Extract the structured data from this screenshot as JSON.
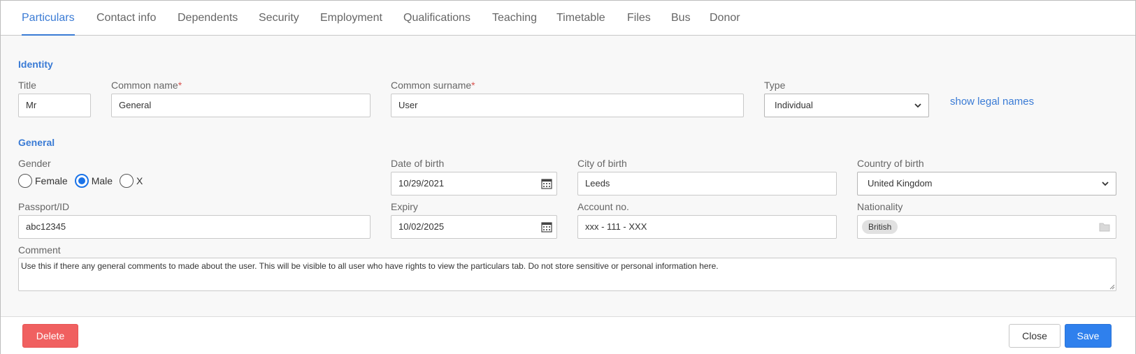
{
  "tabs": [
    "Particulars",
    "Contact info",
    "Dependents",
    "Security",
    "Employment",
    "Qualifications",
    "Teaching",
    "Timetable",
    "Files",
    "Bus",
    "Donor"
  ],
  "active_tab": "Particulars",
  "identity": {
    "heading": "Identity",
    "title_label": "Title",
    "title_value": "Mr",
    "common_name_label": "Common name",
    "common_name_value": "General",
    "common_surname_label": "Common surname",
    "common_surname_value": "User",
    "required_mark": "*",
    "type_label": "Type",
    "type_value": "Individual",
    "show_legal_names": "show legal names"
  },
  "general": {
    "heading": "General",
    "gender_label": "Gender",
    "gender_options": [
      "Female",
      "Male",
      "X"
    ],
    "gender_selected": "Male",
    "dob_label": "Date of birth",
    "dob_value": "10/29/2021",
    "city_label": "City of birth",
    "city_value": "Leeds",
    "country_label": "Country of birth",
    "country_value": "United Kingdom",
    "passport_label": "Passport/ID",
    "passport_value": "abc12345",
    "expiry_label": "Expiry",
    "expiry_value": "10/02/2025",
    "account_label": "Account no.",
    "account_value": "xxx - 111 - XXX",
    "nationality_label": "Nationality",
    "nationality_chip": "British",
    "comment_label": "Comment",
    "comment_value": "Use this if there any general comments to made about the user. This will be visible to all user who have rights to view the particulars tab. Do not store sensitive or personal information here."
  },
  "footer": {
    "delete_label": "Delete",
    "close_label": "Close",
    "save_label": "Save"
  },
  "colors": {
    "accent": "#3a7bd5",
    "danger": "#f06060",
    "primary": "#2f80ed",
    "required": "#d9534f"
  }
}
